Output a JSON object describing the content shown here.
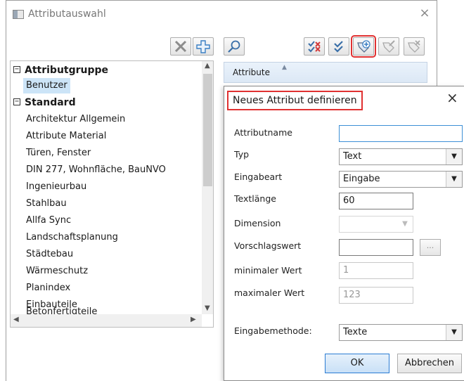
{
  "window": {
    "title": "Attributauswahl",
    "close_symbol": "×"
  },
  "tree": {
    "items": [
      {
        "label": "Attributgruppe",
        "type": "group",
        "expander": "−"
      },
      {
        "label": "Benutzer",
        "type": "item",
        "selected": true
      },
      {
        "label": "Standard",
        "type": "group",
        "expander": "−"
      },
      {
        "label": "Architektur Allgemein",
        "type": "item"
      },
      {
        "label": "Attribute Material",
        "type": "item"
      },
      {
        "label": "Türen, Fenster",
        "type": "item"
      },
      {
        "label": "DIN 277, Wohnfläche, BauNVO",
        "type": "item"
      },
      {
        "label": "Ingenieurbau",
        "type": "item"
      },
      {
        "label": "Stahlbau",
        "type": "item"
      },
      {
        "label": "Allfa Sync",
        "type": "item"
      },
      {
        "label": "Landschaftsplanung",
        "type": "item"
      },
      {
        "label": "Städtebau",
        "type": "item"
      },
      {
        "label": "Wärmeschutz",
        "type": "item"
      },
      {
        "label": "Planindex",
        "type": "item"
      },
      {
        "label": "Einbauteile",
        "type": "item"
      },
      {
        "label": "Betonfertigteile",
        "type": "item"
      }
    ]
  },
  "list": {
    "column_header": "Attribute"
  },
  "dialog": {
    "title": "Neues Attribut definieren",
    "close_symbol": "×",
    "labels": {
      "name": "Attributname",
      "type": "Typ",
      "input_type": "Eingabeart",
      "text_length": "Textlänge",
      "dimension": "Dimension",
      "default_value": "Vorschlagswert",
      "min": "minimaler Wert",
      "max": "maximaler Wert",
      "input_method": "Eingabemethode:"
    },
    "values": {
      "name": "",
      "type": "Text",
      "input_type": "Eingabe",
      "text_length": "60",
      "dimension": "",
      "default_value": "",
      "min": "1",
      "max": "123",
      "input_method": "Texte"
    },
    "browse_label": "...",
    "ok_label": "OK",
    "cancel_label": "Abbrechen"
  },
  "colors": {
    "highlight": "#e03131",
    "selection": "#cce4f7",
    "accent": "#3c8fd6"
  }
}
